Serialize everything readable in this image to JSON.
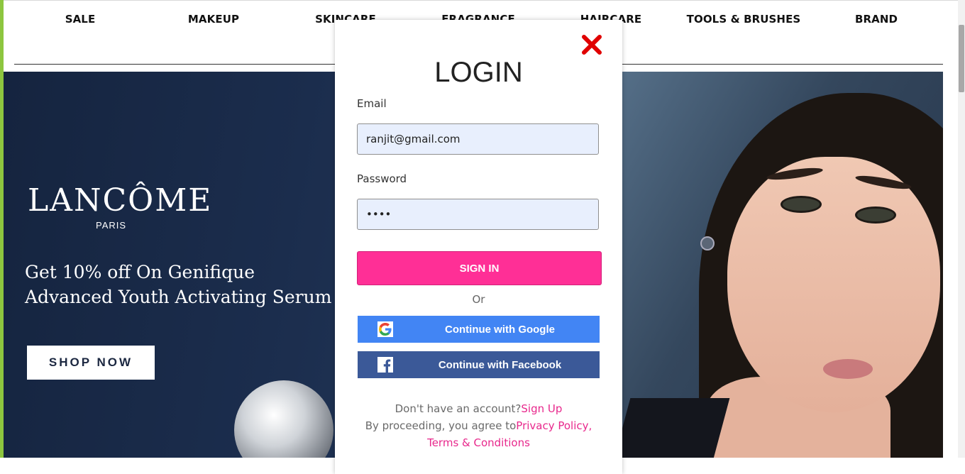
{
  "nav": {
    "items": [
      "SALE",
      "MAKEUP",
      "SKINCARE",
      "FRAGRANCE",
      "HAIRCARE",
      "TOOLS & BRUSHES",
      "BRAND"
    ]
  },
  "banner": {
    "brand": "LANCÔME",
    "brand_sub": "PARIS",
    "promo_line1": "Get 10% off  On Genifique",
    "promo_line2": "Advanced Youth Activating Serum",
    "shop_button": "SHOP NOW"
  },
  "login": {
    "title": "LOGIN",
    "email_label": "Email",
    "email_value": "ranjit@gmail.com",
    "password_label": "Password",
    "password_value": "••••",
    "signin_button": "SIGN IN",
    "or_text": "Or",
    "google_button": "Continue with Google",
    "facebook_button": "Continue with Facebook",
    "no_account_text": "Don't have an account?",
    "signup_link": "Sign Up",
    "agree_text": "By proceeding, you agree to",
    "privacy_link": "Privacy Policy,",
    "terms_link": "Terms & Conditions"
  },
  "colors": {
    "accent_pink": "#ff2f96",
    "google_blue": "#4285f4",
    "facebook_blue": "#3b5998",
    "close_red": "#e00000",
    "banner_navy": "#1b2d4d",
    "left_accent_green": "#8dc63f"
  },
  "icons": [
    "close-icon",
    "google-icon",
    "facebook-icon"
  ]
}
